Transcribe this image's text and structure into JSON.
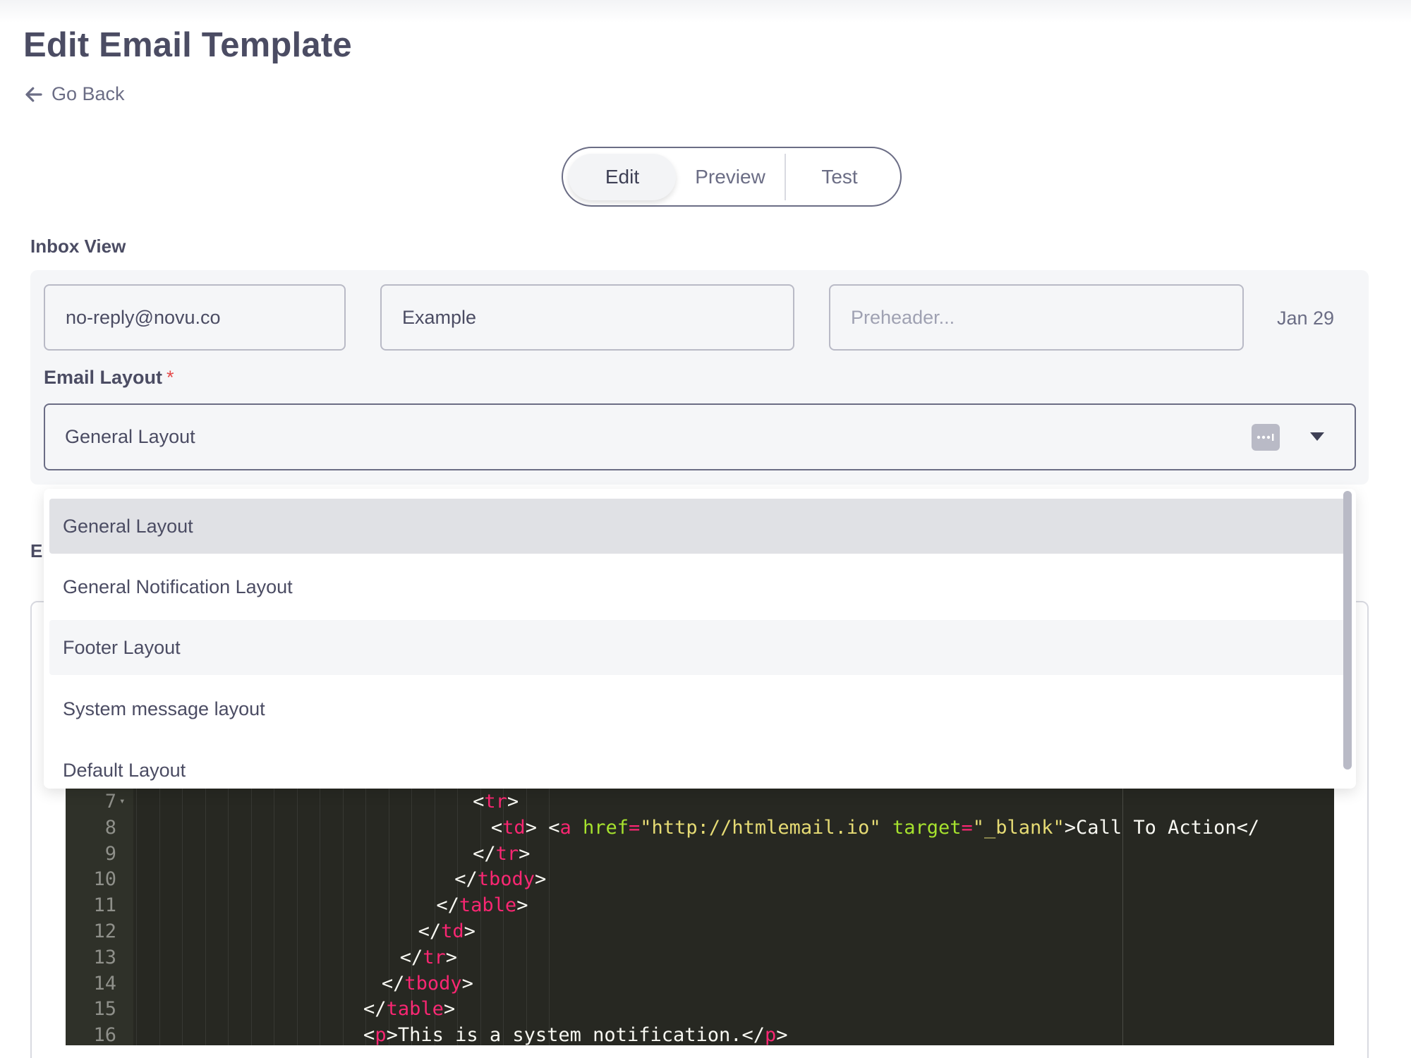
{
  "page": {
    "title": "Edit Email Template",
    "go_back": "Go Back"
  },
  "tabs": [
    {
      "label": "Edit",
      "active": true
    },
    {
      "label": "Preview",
      "active": false
    },
    {
      "label": "Test",
      "active": false
    }
  ],
  "inbox_view": {
    "label": "Inbox View",
    "from_value": "no-reply@novu.co",
    "subject_value": "Example",
    "preheader_placeholder": "Preheader...",
    "date": "Jan 29"
  },
  "email_layout": {
    "label": "Email Layout",
    "required_mark": "*",
    "selected": "General Layout",
    "options": [
      "General Layout",
      "General Notification Layout",
      "Footer Layout",
      "System message layout",
      "Default Layout"
    ],
    "selected_index": 0,
    "hover_index": 2
  },
  "editor": {
    "partial_label": "E",
    "lines": [
      {
        "n": "7",
        "fold": true,
        "indent": 18,
        "tokens": [
          [
            "p",
            "<"
          ],
          [
            "t",
            "tr"
          ],
          [
            "p",
            ">"
          ]
        ]
      },
      {
        "n": "8",
        "fold": false,
        "indent": 19,
        "tokens": [
          [
            "p",
            "<"
          ],
          [
            "t",
            "td"
          ],
          [
            "p",
            "> <"
          ],
          [
            "t",
            "a"
          ],
          [
            "p",
            " "
          ],
          [
            "a",
            "href"
          ],
          [
            "t",
            "="
          ],
          [
            "s",
            "\"http://htmlemail.io\""
          ],
          [
            "p",
            " "
          ],
          [
            "a",
            "target"
          ],
          [
            "t",
            "="
          ],
          [
            "s",
            "\"_blank\""
          ],
          [
            "p",
            ">Call To Action</"
          ]
        ]
      },
      {
        "n": "9",
        "fold": false,
        "indent": 18,
        "tokens": [
          [
            "p",
            "</"
          ],
          [
            "t",
            "tr"
          ],
          [
            "p",
            ">"
          ]
        ]
      },
      {
        "n": "10",
        "fold": false,
        "indent": 17,
        "tokens": [
          [
            "p",
            "</"
          ],
          [
            "t",
            "tbody"
          ],
          [
            "p",
            ">"
          ]
        ]
      },
      {
        "n": "11",
        "fold": false,
        "indent": 16,
        "tokens": [
          [
            "p",
            "</"
          ],
          [
            "t",
            "table"
          ],
          [
            "p",
            ">"
          ]
        ]
      },
      {
        "n": "12",
        "fold": false,
        "indent": 15,
        "tokens": [
          [
            "p",
            "</"
          ],
          [
            "t",
            "td"
          ],
          [
            "p",
            ">"
          ]
        ]
      },
      {
        "n": "13",
        "fold": false,
        "indent": 14,
        "tokens": [
          [
            "p",
            "</"
          ],
          [
            "t",
            "tr"
          ],
          [
            "p",
            ">"
          ]
        ]
      },
      {
        "n": "14",
        "fold": false,
        "indent": 13,
        "tokens": [
          [
            "p",
            "</"
          ],
          [
            "t",
            "tbody"
          ],
          [
            "p",
            ">"
          ]
        ]
      },
      {
        "n": "15",
        "fold": false,
        "indent": 12,
        "tokens": [
          [
            "p",
            "</"
          ],
          [
            "t",
            "table"
          ],
          [
            "p",
            ">"
          ]
        ]
      },
      {
        "n": "16",
        "fold": false,
        "indent": 12,
        "tokens": [
          [
            "p",
            "<"
          ],
          [
            "t",
            "p"
          ],
          [
            "p",
            ">This is a system notification.</"
          ],
          [
            "t",
            "p"
          ],
          [
            "p",
            ">"
          ]
        ]
      }
    ]
  },
  "colors": {
    "accent_text": "#4b4c63",
    "required": "#e54b4b",
    "code_bg": "#272822",
    "code_tag": "#f92672",
    "code_attr": "#a6e22e",
    "code_string": "#e6db74"
  }
}
